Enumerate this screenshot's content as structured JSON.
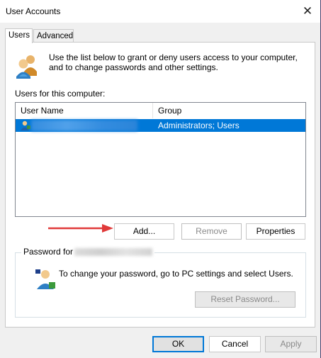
{
  "window": {
    "title": "User Accounts",
    "close_glyph": "✕"
  },
  "tabs": [
    {
      "label": "Users",
      "active": true
    },
    {
      "label": "Advanced",
      "active": false
    }
  ],
  "users_tab": {
    "intro_text": "Use the list below to grant or deny users access to your computer, and to change passwords and other settings.",
    "list_label": "Users for this computer:",
    "columns": [
      "User Name",
      "Group"
    ],
    "rows": [
      {
        "user_name": "",
        "group": "Administrators; Users",
        "selected": true
      }
    ],
    "buttons": {
      "add": "Add...",
      "remove": "Remove",
      "properties": "Properties"
    }
  },
  "password_group": {
    "legend": "Password for",
    "text": "To change your password, go to PC settings and select Users.",
    "reset_button": "Reset Password..."
  },
  "footer": {
    "ok": "OK",
    "cancel": "Cancel",
    "apply": "Apply"
  },
  "colors": {
    "selection": "#0078d7",
    "arrow": "#e03a3a",
    "default_button_border": "#0078d7"
  },
  "icons": {
    "users": "users-icon",
    "row_user": "user-icon",
    "password_user": "user-key-icon",
    "annotation": "red-arrow-icon"
  }
}
